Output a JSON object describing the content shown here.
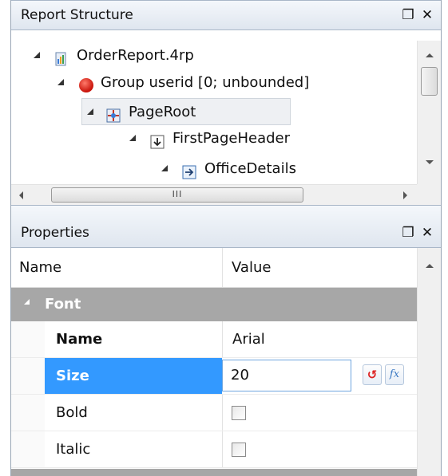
{
  "report_structure_panel": {
    "title": "Report Structure",
    "tree": [
      {
        "label": "OrderReport.4rp",
        "icon": "report-file-icon"
      },
      {
        "label": "Group userid [0; unbounded]",
        "icon": "group-red-circle-icon"
      },
      {
        "label": "PageRoot",
        "icon": "page-root-icon"
      },
      {
        "label": "FirstPageHeader",
        "icon": "page-header-icon"
      },
      {
        "label": "OfficeDetails",
        "icon": "container-icon"
      }
    ],
    "hscroll_thumb": "III"
  },
  "properties_panel": {
    "title": "Properties",
    "columns": {
      "name": "Name",
      "value": "Value"
    },
    "category": "Font",
    "rows": [
      {
        "name": "Name",
        "value": "Arial"
      },
      {
        "name": "Size",
        "value": "20"
      },
      {
        "name": "Bold",
        "value": ""
      },
      {
        "name": "Italic",
        "value": ""
      }
    ],
    "buttons": {
      "fx": "fx"
    }
  },
  "colors": {
    "selection": "#3399ff",
    "category_bg": "#a7a7a7",
    "header_gradient_top": "#f4f7fb"
  }
}
